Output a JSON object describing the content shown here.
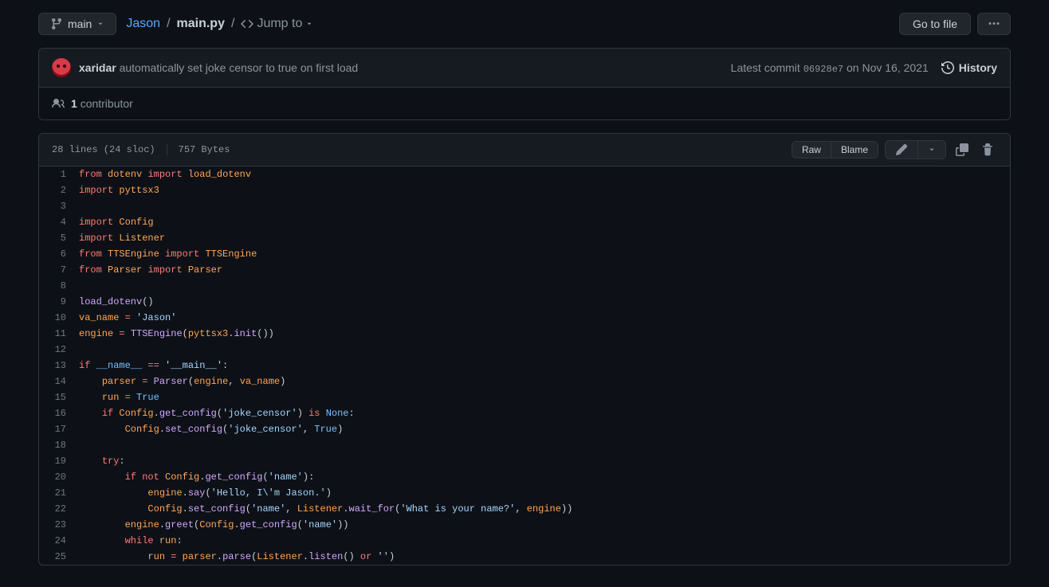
{
  "branch": {
    "name": "main"
  },
  "breadcrumb": {
    "repo": "Jason",
    "filename": "main.py",
    "jumpto": "Jump to"
  },
  "actions": {
    "go_to_file": "Go to file",
    "kebab": "..."
  },
  "commit": {
    "author": "xaridar",
    "message": "automatically set joke censor to true on first load",
    "latest_prefix": "Latest commit",
    "sha": "06928e7",
    "date": "on Nov 16, 2021",
    "history": "History"
  },
  "contributors": {
    "count": "1",
    "label": "contributor"
  },
  "file_meta": {
    "lines_sloc": "28 lines (24 sloc)",
    "bytes": "757 Bytes",
    "raw": "Raw",
    "blame": "Blame"
  },
  "code": [
    {
      "n": 1,
      "html": "<span class=\"pl-k\">from</span> <span class=\"pl-v\">dotenv</span> <span class=\"pl-k\">import</span> <span class=\"pl-v\">load_dotenv</span>"
    },
    {
      "n": 2,
      "html": "<span class=\"pl-k\">import</span> <span class=\"pl-v\">pyttsx3</span>"
    },
    {
      "n": 3,
      "html": ""
    },
    {
      "n": 4,
      "html": "<span class=\"pl-k\">import</span> <span class=\"pl-v\">Config</span>"
    },
    {
      "n": 5,
      "html": "<span class=\"pl-k\">import</span> <span class=\"pl-v\">Listener</span>"
    },
    {
      "n": 6,
      "html": "<span class=\"pl-k\">from</span> <span class=\"pl-v\">TTSEngine</span> <span class=\"pl-k\">import</span> <span class=\"pl-v\">TTSEngine</span>"
    },
    {
      "n": 7,
      "html": "<span class=\"pl-k\">from</span> <span class=\"pl-v\">Parser</span> <span class=\"pl-k\">import</span> <span class=\"pl-v\">Parser</span>"
    },
    {
      "n": 8,
      "html": ""
    },
    {
      "n": 9,
      "html": "<span class=\"pl-en\">load_dotenv</span>()"
    },
    {
      "n": 10,
      "html": "<span class=\"pl-v\">va_name</span> <span class=\"pl-k\">=</span> <span class=\"pl-s\">'Jason'</span>"
    },
    {
      "n": 11,
      "html": "<span class=\"pl-v\">engine</span> <span class=\"pl-k\">=</span> <span class=\"pl-en\">TTSEngine</span>(<span class=\"pl-v\">pyttsx3</span>.<span class=\"pl-en\">init</span>())"
    },
    {
      "n": 12,
      "html": ""
    },
    {
      "n": 13,
      "html": "<span class=\"pl-k\">if</span> <span class=\"pl-c1\">__name__</span> <span class=\"pl-k\">==</span> <span class=\"pl-s\">'__main__'</span>:"
    },
    {
      "n": 14,
      "html": "    <span class=\"pl-v\">parser</span> <span class=\"pl-k\">=</span> <span class=\"pl-en\">Parser</span>(<span class=\"pl-v\">engine</span>, <span class=\"pl-v\">va_name</span>)"
    },
    {
      "n": 15,
      "html": "    <span class=\"pl-v\">run</span> <span class=\"pl-k\">=</span> <span class=\"pl-c1\">True</span>"
    },
    {
      "n": 16,
      "html": "    <span class=\"pl-k\">if</span> <span class=\"pl-v\">Config</span>.<span class=\"pl-en\">get_config</span>(<span class=\"pl-s\">'joke_censor'</span>) <span class=\"pl-k\">is</span> <span class=\"pl-c1\">None</span>:"
    },
    {
      "n": 17,
      "html": "        <span class=\"pl-v\">Config</span>.<span class=\"pl-en\">set_config</span>(<span class=\"pl-s\">'joke_censor'</span>, <span class=\"pl-c1\">True</span>)"
    },
    {
      "n": 18,
      "html": ""
    },
    {
      "n": 19,
      "html": "    <span class=\"pl-k\">try</span>:"
    },
    {
      "n": 20,
      "html": "        <span class=\"pl-k\">if</span> <span class=\"pl-k\">not</span> <span class=\"pl-v\">Config</span>.<span class=\"pl-en\">get_config</span>(<span class=\"pl-s\">'name'</span>):"
    },
    {
      "n": 21,
      "html": "            <span class=\"pl-v\">engine</span>.<span class=\"pl-en\">say</span>(<span class=\"pl-s\">'Hello, I\\'m Jason.'</span>)"
    },
    {
      "n": 22,
      "html": "            <span class=\"pl-v\">Config</span>.<span class=\"pl-en\">set_config</span>(<span class=\"pl-s\">'name'</span>, <span class=\"pl-v\">Listener</span>.<span class=\"pl-en\">wait_for</span>(<span class=\"pl-s\">'What is your name?'</span>, <span class=\"pl-v\">engine</span>))"
    },
    {
      "n": 23,
      "html": "        <span class=\"pl-v\">engine</span>.<span class=\"pl-en\">greet</span>(<span class=\"pl-v\">Config</span>.<span class=\"pl-en\">get_config</span>(<span class=\"pl-s\">'name'</span>))"
    },
    {
      "n": 24,
      "html": "        <span class=\"pl-k\">while</span> <span class=\"pl-v\">run</span>:"
    },
    {
      "n": 25,
      "html": "            <span class=\"pl-v\">run</span> <span class=\"pl-k\">=</span> <span class=\"pl-v\">parser</span>.<span class=\"pl-en\">parse</span>(<span class=\"pl-v\">Listener</span>.<span class=\"pl-en\">listen</span>() <span class=\"pl-k\">or</span> <span class=\"pl-s\">''</span>)"
    }
  ]
}
